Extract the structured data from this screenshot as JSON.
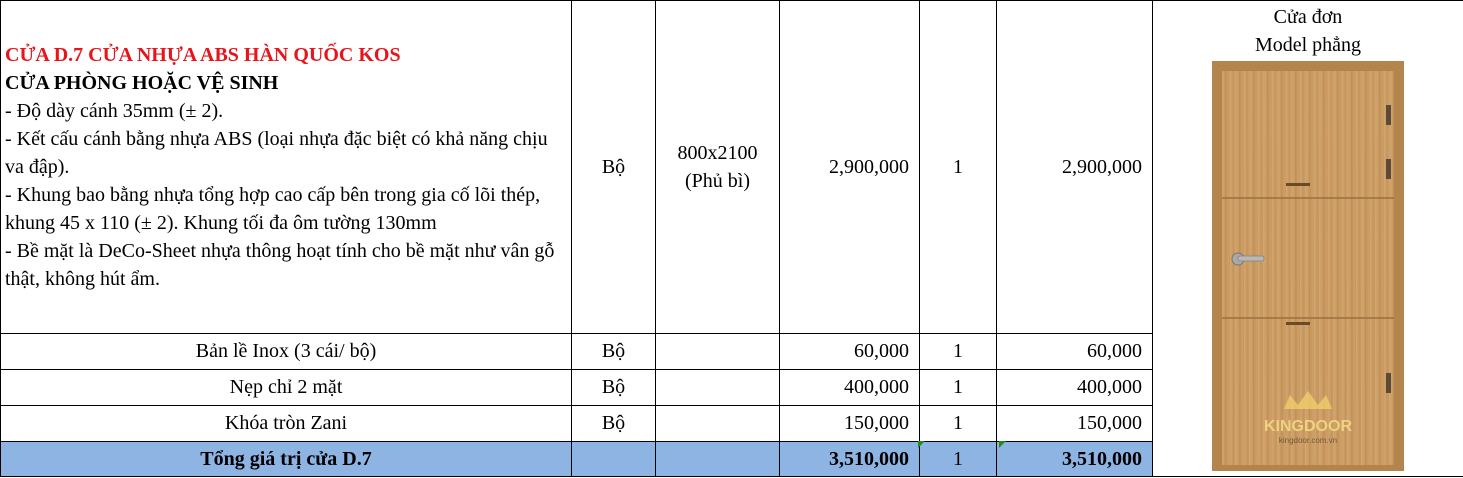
{
  "product": {
    "title_line1": "CỬA D.7 CỬA NHỰA ABS HÀN QUỐC KOS",
    "title_line2": "CỬA PHÒNG HOẶC VỆ SINH",
    "features": [
      "- Độ dày cánh 35mm (± 2).",
      "- Kết cấu cánh bằng nhựa ABS (loại nhựa đặc biệt có khả năng chịu va đập).",
      "- Khung bao bằng nhựa tổng hợp cao cấp bên trong gia cố lõi thép, khung 45 x 110 (± 2). Khung tối đa ôm tường 130mm",
      "- Bề mặt là DeCo-Sheet nhựa thông hoạt tính cho bề mặt như vân gỗ thật, không hút ẩm."
    ],
    "unit": "Bộ",
    "size_line1": "800x2100",
    "size_line2": "(Phủ bì)",
    "price": "2,900,000",
    "qty": "1",
    "amount": "2,900,000"
  },
  "accessories": [
    {
      "name": "Bản lề Inox  (3 cái/ bộ)",
      "unit": "Bộ",
      "size": "",
      "price": "60,000",
      "qty": "1",
      "amount": "60,000"
    },
    {
      "name": "Nẹp chỉ 2 mặt",
      "unit": "Bộ",
      "size": "",
      "price": "400,000",
      "qty": "1",
      "amount": "400,000"
    },
    {
      "name": "Khóa tròn Zani",
      "unit": "Bộ",
      "size": "",
      "price": "150,000",
      "qty": "1",
      "amount": "150,000"
    }
  ],
  "total": {
    "label": "Tổng giá trị cửa D.7",
    "price": "3,510,000",
    "qty": "1",
    "amount": "3,510,000"
  },
  "image": {
    "caption_line1": "Cửa đơn",
    "caption_line2": "Model phẳng",
    "watermark_brand": "KINGDOOR",
    "watermark_site": "kingdoor.com.vn"
  },
  "colors": {
    "title_red": "#e8141b",
    "total_bg": "#8eb4e3",
    "door_wood": "#c79a61",
    "door_frame": "#b4844d"
  }
}
